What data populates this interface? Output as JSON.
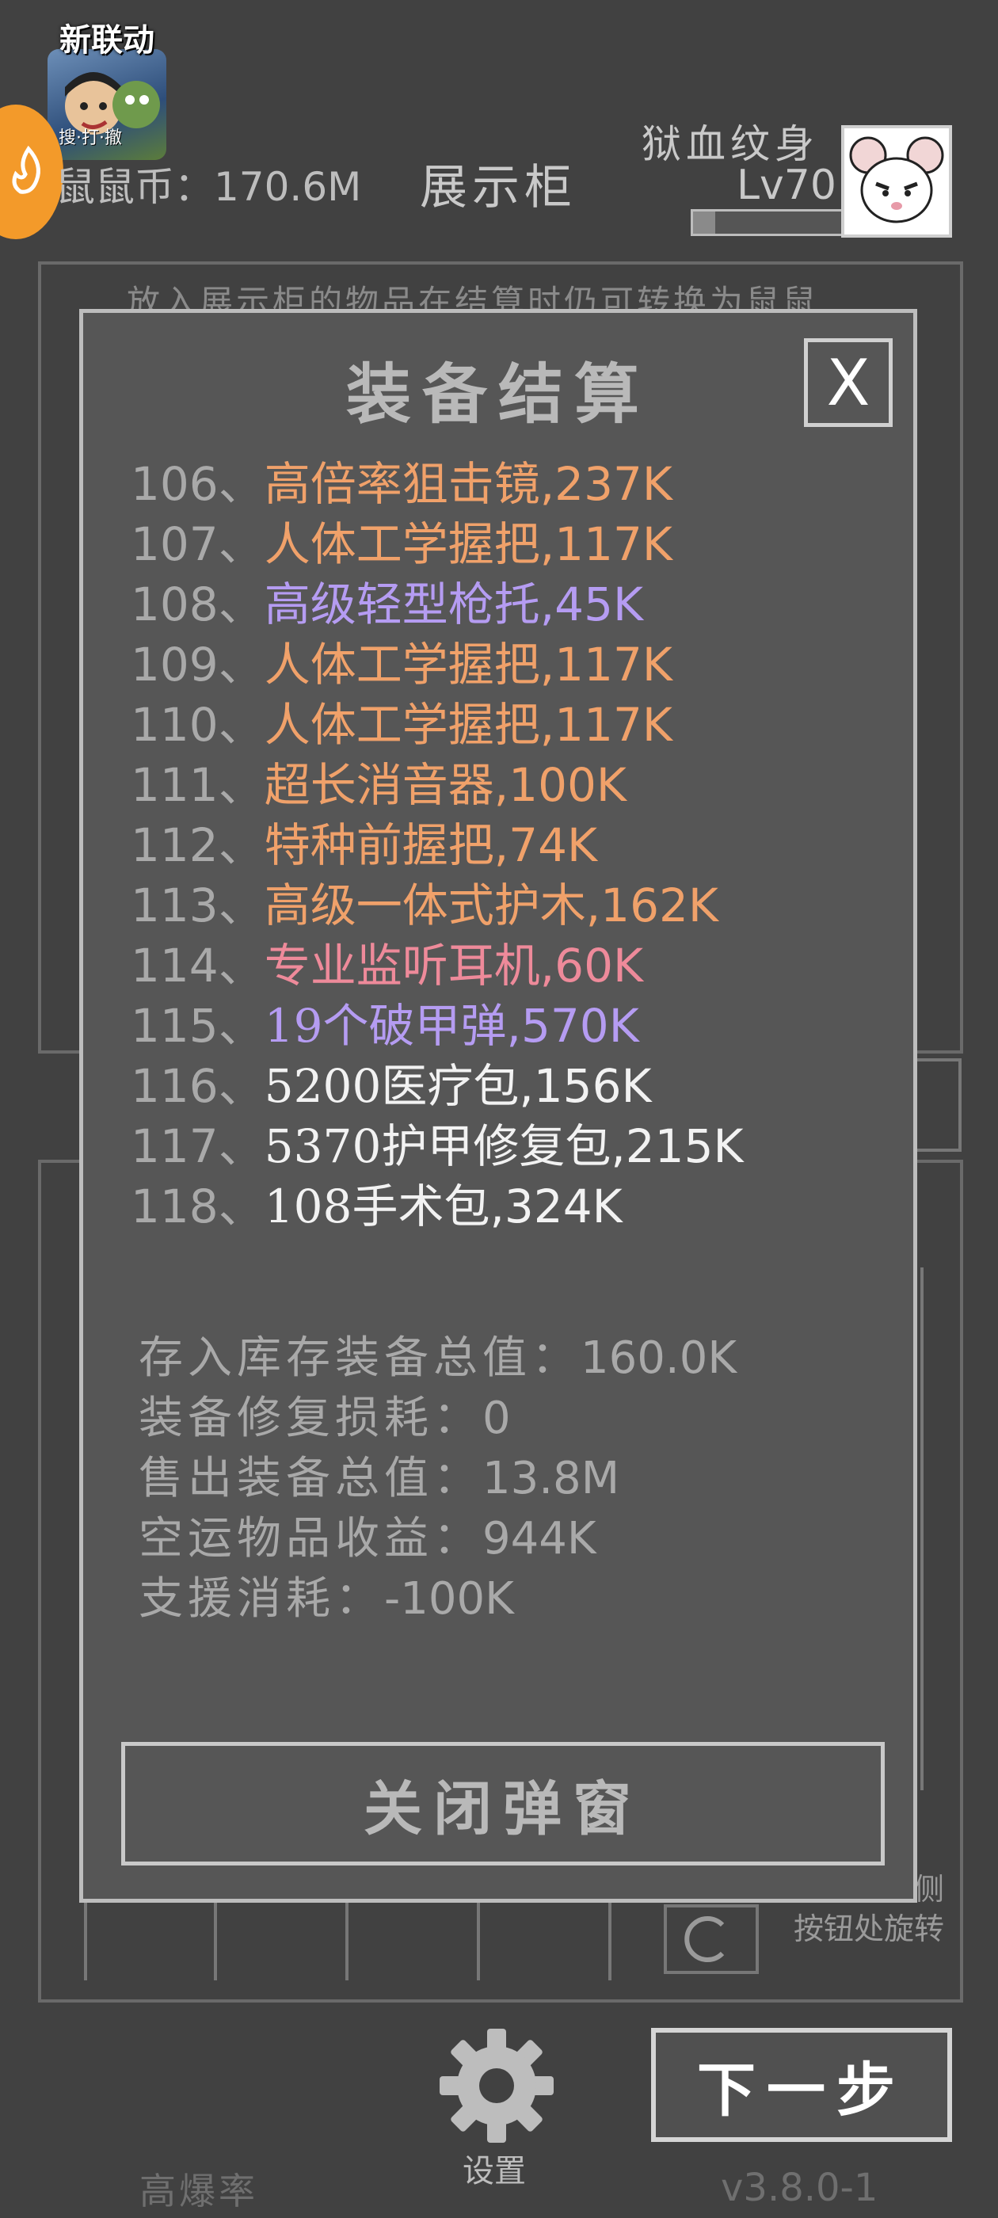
{
  "collab": {
    "title": "新联动",
    "subtitle": "搜·打·撤"
  },
  "header": {
    "coins_label": "鼠鼠币：",
    "coins_value": "170.6M",
    "page_title": "展示柜",
    "player_name": "狱血纹身",
    "player_level": "Lv70",
    "xp_progress": 0.15
  },
  "panel": {
    "note": "放入展示柜的物品在结算时仍可转换为鼠鼠"
  },
  "rotate_hint": {
    "line1": "侧",
    "line2": "按钮处旋转"
  },
  "modal": {
    "title": "装备结算",
    "close_label": "X",
    "items": [
      {
        "index": "106",
        "name": "高倍率狙击镜",
        "value": ",237K",
        "color": "#f0a16a"
      },
      {
        "index": "107",
        "name": "人体工学握把",
        "value": ",117K",
        "color": "#f0a16a"
      },
      {
        "index": "108",
        "name": "高级轻型枪托",
        "value": ",45K",
        "color": "#b59cf2"
      },
      {
        "index": "109",
        "name": "人体工学握把",
        "value": ",117K",
        "color": "#f0a16a"
      },
      {
        "index": "110",
        "name": "人体工学握把",
        "value": ",117K",
        "color": "#f0a16a"
      },
      {
        "index": "111",
        "name": "超长消音器",
        "value": ",100K",
        "color": "#f0a16a"
      },
      {
        "index": "112",
        "name": "特种前握把",
        "value": ",74K",
        "color": "#f0a16a"
      },
      {
        "index": "113",
        "name": "高级一体式护木",
        "value": ",162K",
        "color": "#f0a16a"
      },
      {
        "index": "114",
        "name": "专业监听耳机",
        "value": ",60K",
        "color": "#ee8a9a"
      },
      {
        "index": "115",
        "name": "19个破甲弹",
        "value": ",570K",
        "color": "#b59cf2"
      },
      {
        "index": "116",
        "name": "5200医疗包",
        "value": ",156K",
        "color": "#f2f2f2"
      },
      {
        "index": "117",
        "name": "5370护甲修复包",
        "value": ",215K",
        "color": "#f2f2f2"
      },
      {
        "index": "118",
        "name": "108手术包",
        "value": ",324K",
        "color": "#f2f2f2"
      }
    ],
    "summary": [
      {
        "label": "存入库存装备总值：",
        "value": "160.0K"
      },
      {
        "label": "装备修复损耗：",
        "value": "0"
      },
      {
        "label": "售出装备总值：",
        "value": "13.8M"
      },
      {
        "label": "空运物品收益：",
        "value": "944K"
      },
      {
        "label": "支援消耗：",
        "value": "-100K"
      }
    ],
    "close_popup_label": "关闭弹窗"
  },
  "footer": {
    "settings_label": "设置",
    "next_label": "下一步",
    "high_rate_label": "高爆率",
    "version": "v3.8.0-1"
  }
}
